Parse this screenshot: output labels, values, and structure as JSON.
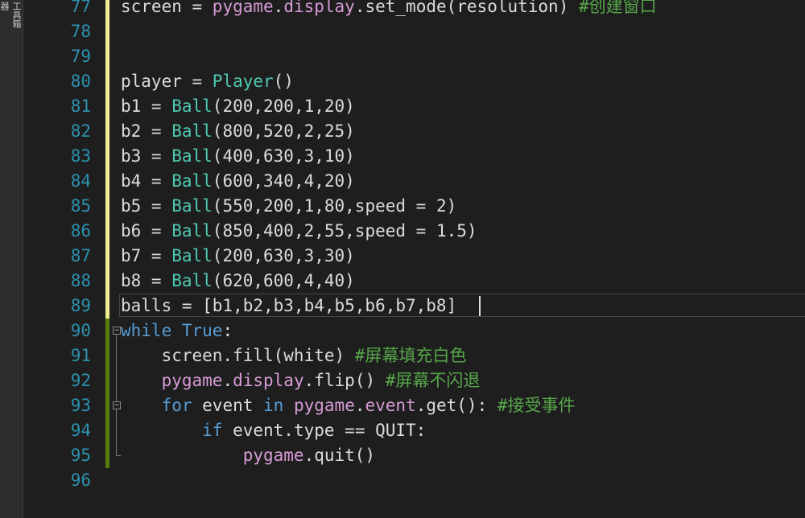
{
  "toolstrip": {
    "tab_a": "器",
    "tab_b": "工具箱"
  },
  "editor": {
    "lines": [
      {
        "num": "77",
        "segments": [
          [
            "plain",
            "screen = "
          ],
          [
            "mod",
            "pygame"
          ],
          [
            "plain",
            "."
          ],
          [
            "mod",
            "display"
          ],
          [
            "plain",
            "."
          ],
          [
            "plain",
            "set_mode(resolution) "
          ],
          [
            "cmt",
            "#创建窗口"
          ]
        ]
      },
      {
        "num": "78",
        "segments": []
      },
      {
        "num": "79",
        "segments": []
      },
      {
        "num": "80",
        "segments": [
          [
            "plain",
            "player = "
          ],
          [
            "cls",
            "Player"
          ],
          [
            "plain",
            "()"
          ]
        ]
      },
      {
        "num": "81",
        "segments": [
          [
            "plain",
            "b1 = "
          ],
          [
            "cls",
            "Ball"
          ],
          [
            "plain",
            "(200,200,1,20)"
          ]
        ]
      },
      {
        "num": "82",
        "segments": [
          [
            "plain",
            "b2 = "
          ],
          [
            "cls",
            "Ball"
          ],
          [
            "plain",
            "(800,520,2,25)"
          ]
        ]
      },
      {
        "num": "83",
        "segments": [
          [
            "plain",
            "b3 = "
          ],
          [
            "cls",
            "Ball"
          ],
          [
            "plain",
            "(400,630,3,10)"
          ]
        ]
      },
      {
        "num": "84",
        "segments": [
          [
            "plain",
            "b4 = "
          ],
          [
            "cls",
            "Ball"
          ],
          [
            "plain",
            "(600,340,4,20)"
          ]
        ]
      },
      {
        "num": "85",
        "segments": [
          [
            "plain",
            "b5 = "
          ],
          [
            "cls",
            "Ball"
          ],
          [
            "plain",
            "(550,200,1,80,speed = 2)"
          ]
        ]
      },
      {
        "num": "86",
        "segments": [
          [
            "plain",
            "b6 = "
          ],
          [
            "cls",
            "Ball"
          ],
          [
            "plain",
            "(850,400,2,55,speed = 1.5)"
          ]
        ]
      },
      {
        "num": "87",
        "segments": [
          [
            "plain",
            "b7 = "
          ],
          [
            "cls",
            "Ball"
          ],
          [
            "plain",
            "(200,630,3,30)"
          ]
        ]
      },
      {
        "num": "88",
        "segments": [
          [
            "plain",
            "b8 = "
          ],
          [
            "cls",
            "Ball"
          ],
          [
            "plain",
            "(620,600,4,40)"
          ]
        ]
      },
      {
        "num": "89",
        "segments": [
          [
            "plain",
            "balls = [b1,b2,b3,b4,b5,b6,b7,b8]"
          ]
        ]
      },
      {
        "num": "90",
        "segments": [
          [
            "kw",
            "while"
          ],
          [
            "plain",
            " "
          ],
          [
            "kw",
            "True"
          ],
          [
            "plain",
            ":"
          ]
        ]
      },
      {
        "num": "91",
        "segments": [
          [
            "plain",
            "    screen.fill(white) "
          ],
          [
            "cmt",
            "#屏幕填充白色"
          ]
        ]
      },
      {
        "num": "92",
        "segments": [
          [
            "plain",
            "    "
          ],
          [
            "mod",
            "pygame"
          ],
          [
            "plain",
            "."
          ],
          [
            "mod",
            "display"
          ],
          [
            "plain",
            ".flip() "
          ],
          [
            "cmt",
            "#屏幕不闪退"
          ]
        ]
      },
      {
        "num": "93",
        "segments": [
          [
            "plain",
            "    "
          ],
          [
            "kw",
            "for"
          ],
          [
            "plain",
            " event "
          ],
          [
            "kw",
            "in"
          ],
          [
            "plain",
            " "
          ],
          [
            "mod",
            "pygame"
          ],
          [
            "plain",
            "."
          ],
          [
            "mod",
            "event"
          ],
          [
            "plain",
            ".get(): "
          ],
          [
            "cmt",
            "#接受事件"
          ]
        ]
      },
      {
        "num": "94",
        "segments": [
          [
            "plain",
            "        "
          ],
          [
            "kw",
            "if"
          ],
          [
            "plain",
            " event.type == QUIT:"
          ]
        ]
      },
      {
        "num": "95",
        "segments": [
          [
            "plain",
            "            "
          ],
          [
            "mod",
            "pygame"
          ],
          [
            "plain",
            ".quit()"
          ]
        ]
      },
      {
        "num": "96",
        "segments": []
      }
    ],
    "colors": {
      "background": "#1e1e1e",
      "line_number": "#2b91af",
      "keyword": "#569cd6",
      "class": "#4ec9b0",
      "module": "#d69bd6",
      "comment": "#57a64a",
      "text": "#dcdcdc",
      "change_unsaved": "#efef91",
      "change_saved": "#587c0c"
    }
  }
}
